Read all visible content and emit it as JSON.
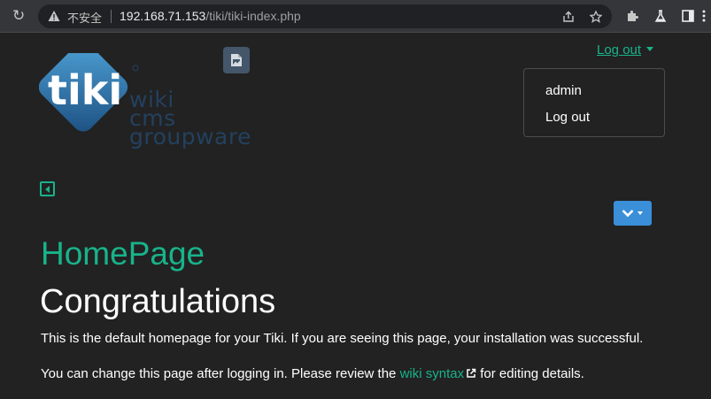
{
  "browser": {
    "insecure_label": "不安全",
    "url_host": "192.168.71.153",
    "url_path": "/tiki/tiki-index.php"
  },
  "header": {
    "logo_lines": [
      "wiki",
      "cms",
      "groupware"
    ],
    "logo_word": "tiki",
    "logout_toggle": "Log out",
    "menu": {
      "username": "admin",
      "logout": "Log out"
    }
  },
  "content": {
    "page_title": "HomePage",
    "heading": "Congratulations",
    "paragraph1": "This is the default homepage for your Tiki. If you are seeing this page, your installation was successful.",
    "paragraph2_before": "You can change this page after logging in. Please review the ",
    "paragraph2_link": "wiki syntax",
    "paragraph2_after": " for editing details."
  },
  "colors": {
    "accent_green": "#18b38a",
    "button_blue": "#3a8fd8",
    "background": "#222222"
  },
  "icons": [
    "reload-icon",
    "warning-icon",
    "share-icon",
    "star-icon",
    "extensions-icon",
    "labs-icon",
    "sidepanel-icon",
    "menu-dots-icon",
    "document-icon",
    "collapse-left-icon",
    "chevron-down-icon",
    "external-link-icon"
  ]
}
